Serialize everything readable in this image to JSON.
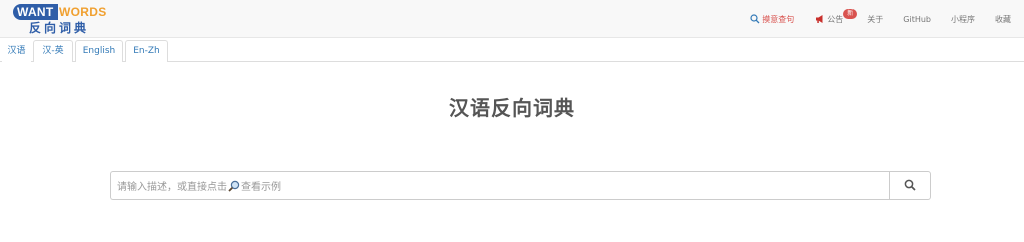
{
  "logo": {
    "part1": "WANT",
    "part2": "WORDS",
    "subtitle": "反向词典"
  },
  "nav": {
    "search_example": "摸意查句",
    "announcement": "公告",
    "announcement_badge": "新",
    "about": "关于",
    "github": "GitHub",
    "mini_program": "小程序",
    "favorites": "收藏"
  },
  "tabs": [
    {
      "label": "汉语",
      "active": true
    },
    {
      "label": "汉-英",
      "active": false
    },
    {
      "label": "English",
      "active": false
    },
    {
      "label": "En-Zh",
      "active": false
    }
  ],
  "page_title": "汉语反向词典",
  "search": {
    "placeholder_before": "请输入描述，或直接点击",
    "placeholder_after": "查看示例"
  },
  "colors": {
    "brand_blue": "#2f5ea8",
    "brand_orange": "#f0a030",
    "link_blue": "#337ab7",
    "accent_red": "#d9534f"
  },
  "icons": [
    "search-icon",
    "megaphone-icon",
    "magnifier-icon"
  ]
}
